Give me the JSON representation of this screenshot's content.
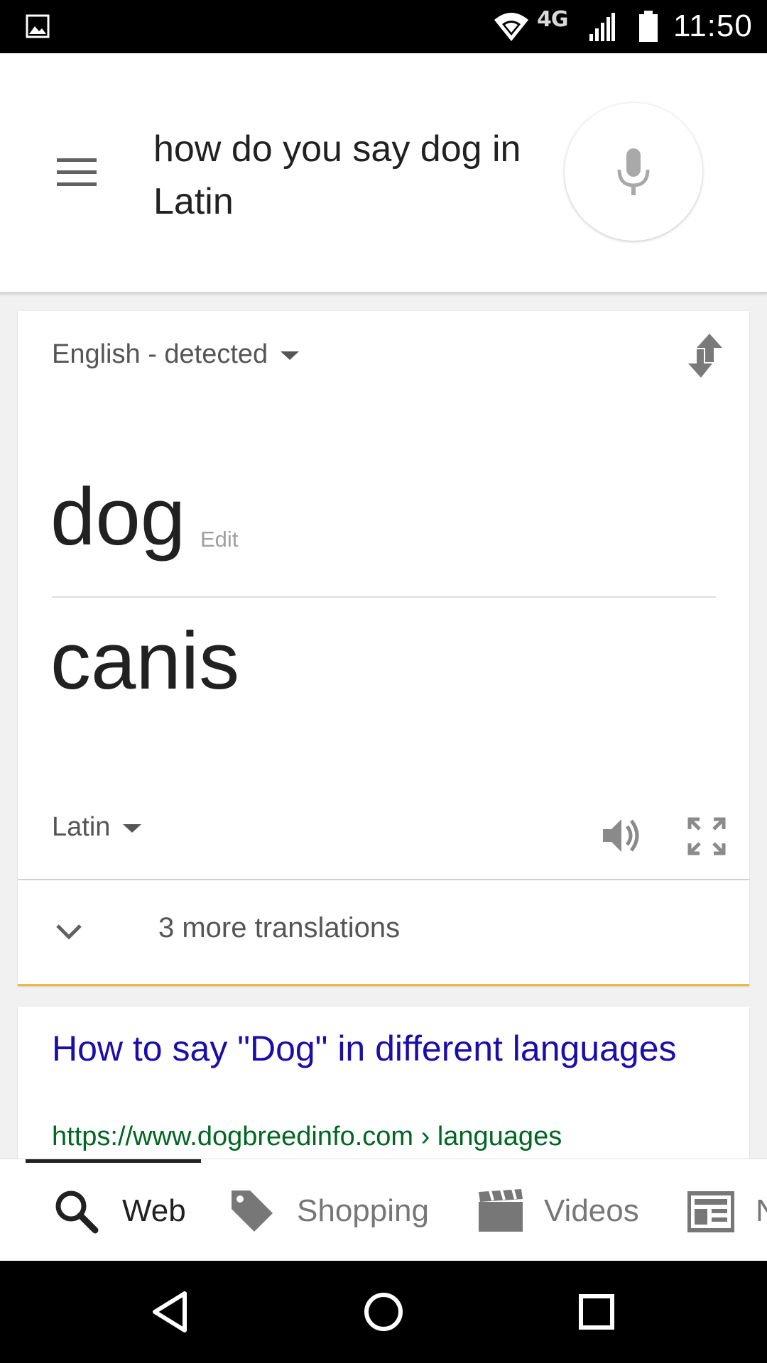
{
  "status_bar": {
    "network": "4G",
    "time": "11:50",
    "icons": [
      "gallery-icon",
      "wifi-icon",
      "signal-icon",
      "battery-icon"
    ]
  },
  "search": {
    "query": "how do you say dog in Latin",
    "menu_icon": "hamburger-menu-icon",
    "mic_icon": "microphone-icon"
  },
  "translate_card": {
    "source_language": "English - detected",
    "source_text": "dog",
    "edit_label": "Edit",
    "translated_text": "canis",
    "target_language": "Latin",
    "more_translations": "3 more translations",
    "accent_color": "#f5b73b"
  },
  "result": {
    "title": "How to say \"Dog\" in different languages",
    "url": "https://www.dogbreedinfo.com › languages",
    "title_color": "#1a0dab",
    "url_color": "#006621"
  },
  "tabs": {
    "items": [
      {
        "label": "Web",
        "icon": "search-icon",
        "active": true
      },
      {
        "label": "Shopping",
        "icon": "tag-icon",
        "active": false
      },
      {
        "label": "Videos",
        "icon": "clapperboard-icon",
        "active": false
      },
      {
        "label": "N",
        "icon": "newspaper-icon",
        "active": false
      }
    ]
  },
  "nav_bar": {
    "buttons": [
      "back-icon",
      "home-icon",
      "recents-icon"
    ]
  }
}
